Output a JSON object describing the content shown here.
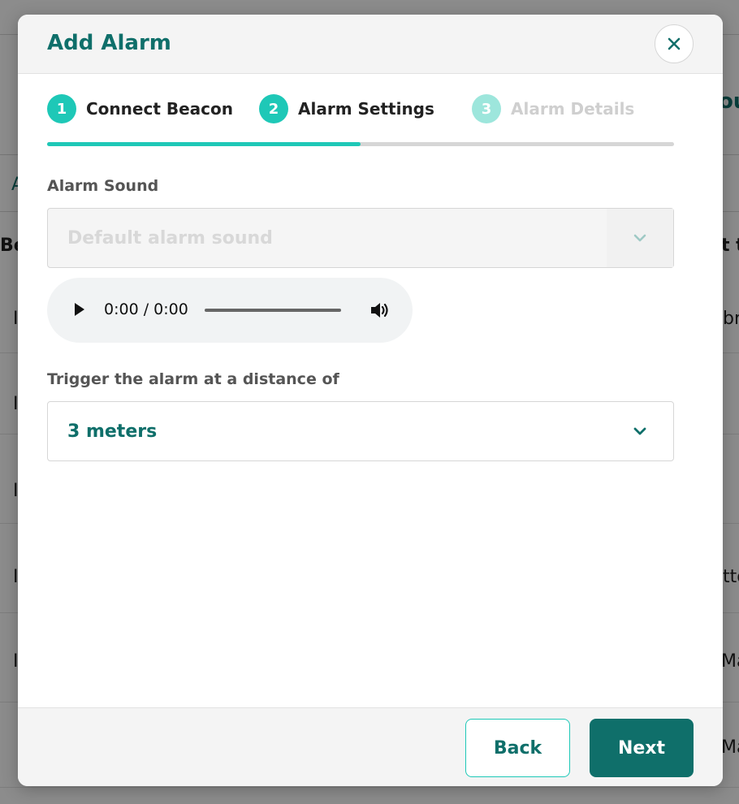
{
  "modal": {
    "title": "Add Alarm",
    "steps": [
      {
        "number": "1",
        "label": "Connect Beacon",
        "state": "completed"
      },
      {
        "number": "2",
        "label": "Alarm Settings",
        "state": "current"
      },
      {
        "number": "3",
        "label": "Alarm Details",
        "state": "upcoming"
      }
    ],
    "progress_fraction": 0.5,
    "alarm_sound": {
      "label": "Alarm Sound",
      "value": "Default alarm sound",
      "disabled": true
    },
    "audio_player": {
      "time": "0:00 / 0:00"
    },
    "distance": {
      "label": "Trigger the alarm at a distance of",
      "value": "3 meters"
    },
    "buttons": {
      "back": "Back",
      "next": "Next"
    }
  },
  "background": {
    "fragments": [
      "Be",
      "ou",
      "A",
      "t t",
      "I",
      "br",
      "I",
      "I",
      "tto",
      "I",
      "Ma",
      "I",
      "Ma"
    ]
  },
  "colors": {
    "brand_dark": "#0f6f6a",
    "brand_accent": "#1ec8b7",
    "overlay": "rgba(0,0,0,0.45)"
  }
}
